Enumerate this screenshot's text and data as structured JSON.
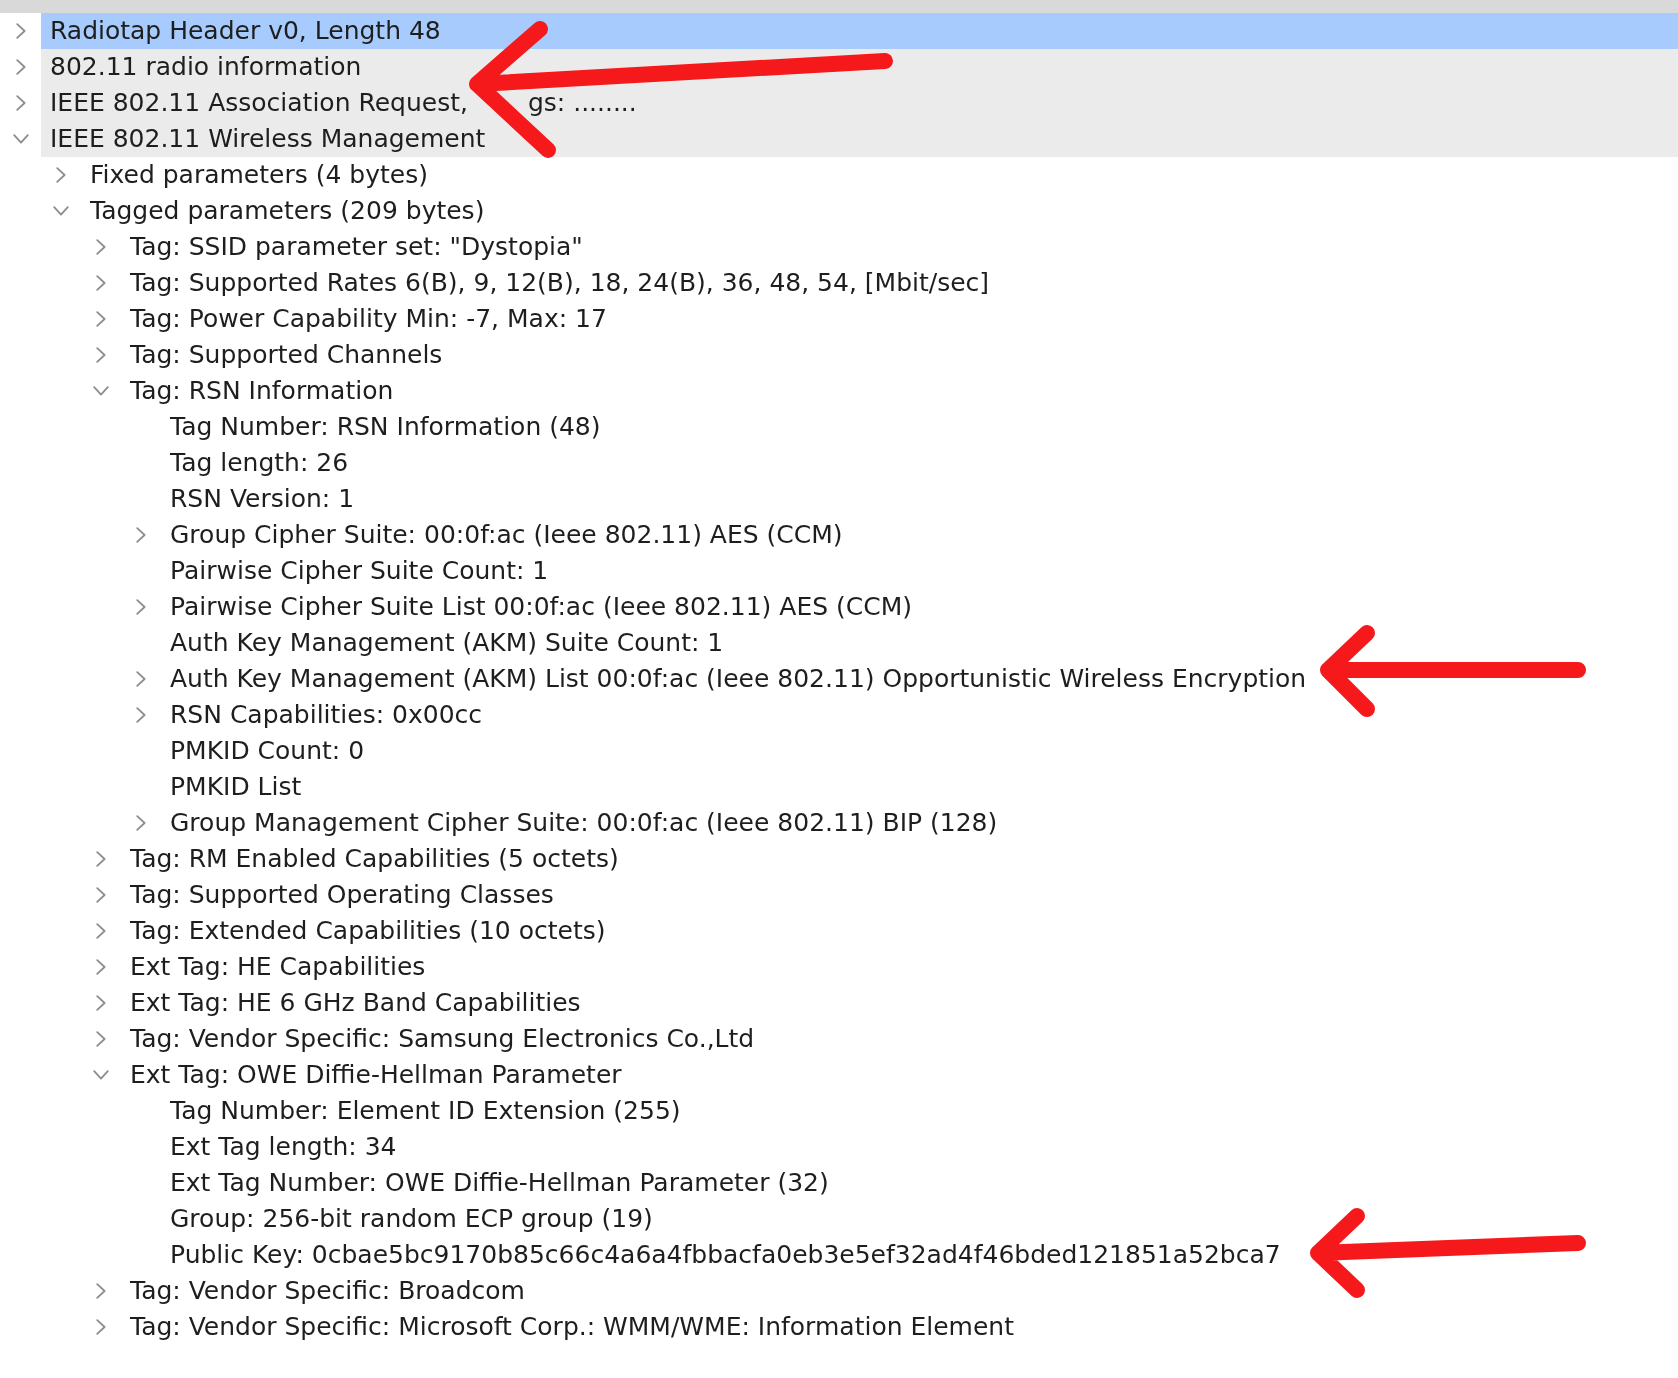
{
  "tree": [
    {
      "label": "Radiotap Header v0, Length 48",
      "kind": "branch",
      "expanded": false,
      "selected": true
    },
    {
      "label": "802.11 radio information",
      "kind": "branch",
      "expanded": false,
      "selected": false
    },
    {
      "label": "IEEE 802.11 Association Request,",
      "visible_tail": "gs: ........",
      "kind": "branch",
      "expanded": false,
      "selected": false
    },
    {
      "label": "IEEE 802.11 Wireless Management",
      "kind": "branch",
      "expanded": true,
      "selected": false,
      "children": [
        {
          "label": "Fixed parameters (4 bytes)",
          "kind": "branch",
          "expanded": false,
          "selected": false
        },
        {
          "label": "Tagged parameters (209 bytes)",
          "kind": "branch",
          "expanded": true,
          "selected": false,
          "children": [
            {
              "label": "Tag: SSID parameter set: \"Dystopia\"",
              "kind": "branch",
              "expanded": false,
              "selected": false
            },
            {
              "label": "Tag: Supported Rates 6(B), 9, 12(B), 18, 24(B), 36, 48, 54, [Mbit/sec]",
              "kind": "branch",
              "expanded": false,
              "selected": false
            },
            {
              "label": "Tag: Power Capability Min: -7, Max: 17",
              "kind": "branch",
              "expanded": false,
              "selected": false
            },
            {
              "label": "Tag: Supported Channels",
              "kind": "branch",
              "expanded": false,
              "selected": false
            },
            {
              "label": "Tag: RSN Information",
              "kind": "branch",
              "expanded": true,
              "selected": false,
              "children": [
                {
                  "label": "Tag Number: RSN Information (48)",
                  "kind": "leaf",
                  "selected": false
                },
                {
                  "label": "Tag length: 26",
                  "kind": "leaf",
                  "selected": false
                },
                {
                  "label": "RSN Version: 1",
                  "kind": "leaf",
                  "selected": false
                },
                {
                  "label": "Group Cipher Suite: 00:0f:ac (Ieee 802.11) AES (CCM)",
                  "kind": "branch",
                  "expanded": false,
                  "selected": false
                },
                {
                  "label": "Pairwise Cipher Suite Count: 1",
                  "kind": "leaf",
                  "selected": false
                },
                {
                  "label": "Pairwise Cipher Suite List 00:0f:ac (Ieee 802.11) AES (CCM)",
                  "kind": "branch",
                  "expanded": false,
                  "selected": false
                },
                {
                  "label": "Auth Key Management (AKM) Suite Count: 1",
                  "kind": "leaf",
                  "selected": false
                },
                {
                  "label": "Auth Key Management (AKM) List 00:0f:ac (Ieee 802.11) Opportunistic Wireless Encryption",
                  "kind": "branch",
                  "expanded": false,
                  "selected": false
                },
                {
                  "label": "RSN Capabilities: 0x00cc",
                  "kind": "branch",
                  "expanded": false,
                  "selected": false
                },
                {
                  "label": "PMKID Count: 0",
                  "kind": "leaf",
                  "selected": false
                },
                {
                  "label": "PMKID List",
                  "kind": "leaf",
                  "selected": false
                },
                {
                  "label": "Group Management Cipher Suite: 00:0f:ac (Ieee 802.11) BIP (128)",
                  "kind": "branch",
                  "expanded": false,
                  "selected": false
                }
              ]
            },
            {
              "label": "Tag: RM Enabled Capabilities (5 octets)",
              "kind": "branch",
              "expanded": false,
              "selected": false
            },
            {
              "label": "Tag: Supported Operating Classes",
              "kind": "branch",
              "expanded": false,
              "selected": false
            },
            {
              "label": "Tag: Extended Capabilities (10 octets)",
              "kind": "branch",
              "expanded": false,
              "selected": false
            },
            {
              "label": "Ext Tag: HE Capabilities",
              "kind": "branch",
              "expanded": false,
              "selected": false
            },
            {
              "label": "Ext Tag: HE 6 GHz Band Capabilities",
              "kind": "branch",
              "expanded": false,
              "selected": false
            },
            {
              "label": "Tag: Vendor Specific: Samsung Electronics Co.,Ltd",
              "kind": "branch",
              "expanded": false,
              "selected": false
            },
            {
              "label": "Ext Tag: OWE Diffie-Hellman Parameter",
              "kind": "branch",
              "expanded": true,
              "selected": false,
              "children": [
                {
                  "label": "Tag Number: Element ID Extension (255)",
                  "kind": "leaf",
                  "selected": false
                },
                {
                  "label": "Ext Tag length: 34",
                  "kind": "leaf",
                  "selected": false
                },
                {
                  "label": "Ext Tag Number: OWE Diffie-Hellman Parameter (32)",
                  "kind": "leaf",
                  "selected": false
                },
                {
                  "label": "Group: 256-bit random ECP group (19)",
                  "kind": "leaf",
                  "selected": false
                },
                {
                  "label": "Public Key: 0cbae5bc9170b85c66c4a6a4fbbacfa0eb3e5ef32ad4f46bded121851a52bca7",
                  "kind": "leaf",
                  "selected": false
                }
              ]
            },
            {
              "label": "Tag: Vendor Specific: Broadcom",
              "kind": "branch",
              "expanded": false,
              "selected": false
            },
            {
              "label": "Tag: Vendor Specific: Microsoft Corp.: WMM/WME: Information Element",
              "kind": "branch",
              "expanded": false,
              "selected": false
            }
          ]
        }
      ]
    }
  ]
}
